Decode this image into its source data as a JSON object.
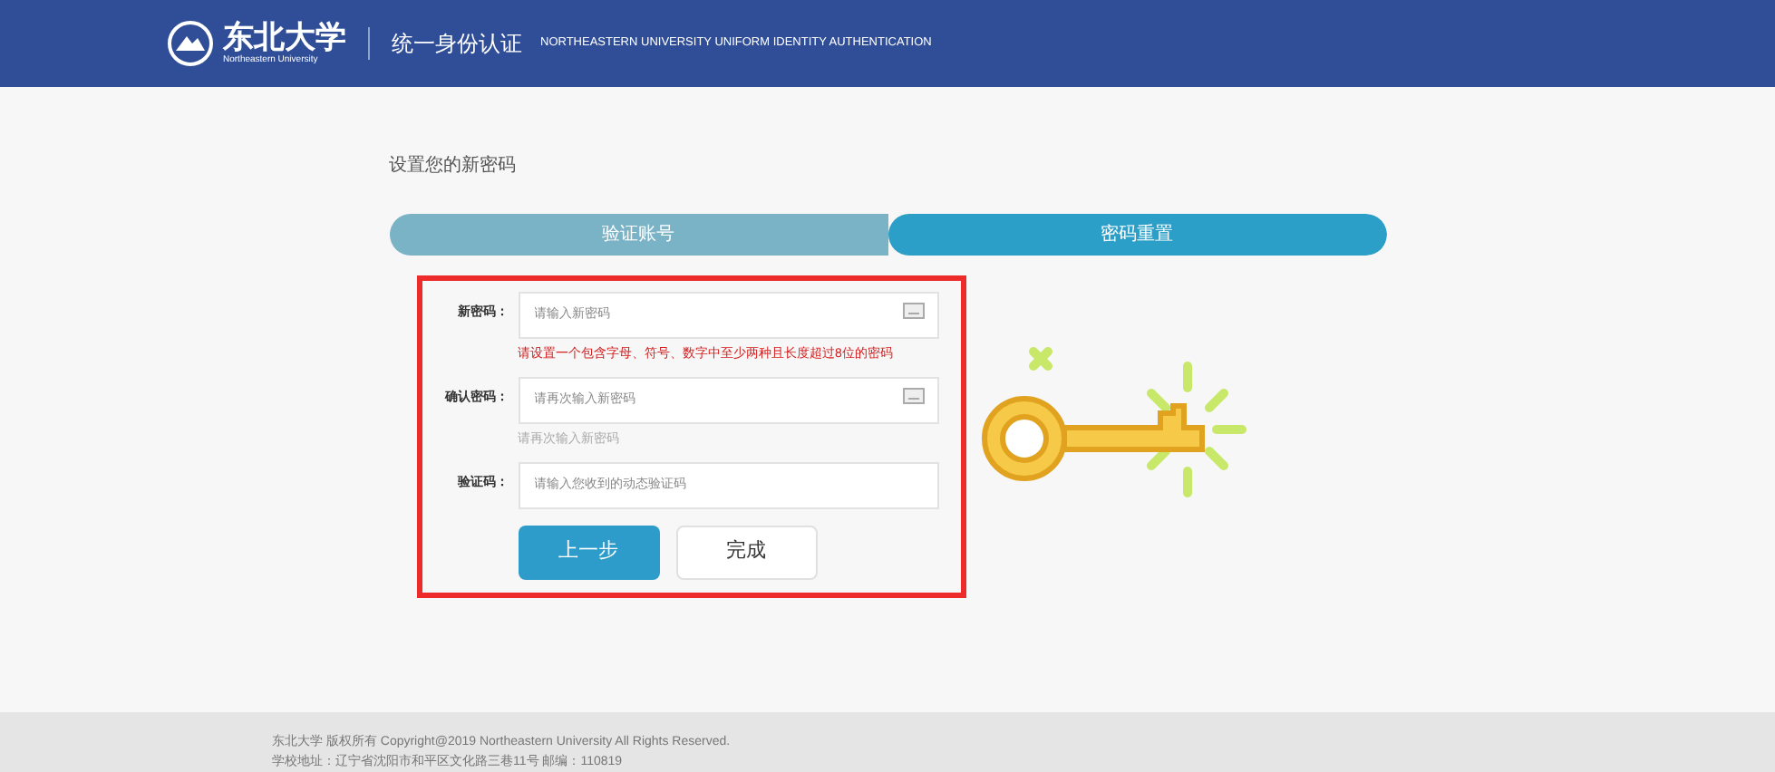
{
  "header": {
    "logo_text": "东北大学",
    "logo_subtext": "Northeastern University",
    "title": "统一身份认证",
    "subtitle": "NORTHEASTERN UNIVERSITY UNIFORM IDENTITY AUTHENTICATION"
  },
  "page_title": "设置您的新密码",
  "steps": [
    {
      "label": "验证账号",
      "selected": false
    },
    {
      "label": "密码重置",
      "selected": true
    }
  ],
  "form": {
    "fields": [
      {
        "label": "新密码：",
        "placeholder": "请输入新密码",
        "keyboard": true,
        "hint": "请设置一个包含字母、符号、数字中至少两种且长度超过8位的密码",
        "error": true
      },
      {
        "label": "确认密码：",
        "placeholder": "请再次输入新密码",
        "keyboard": true,
        "hint": "请再次输入新密码",
        "error": false
      },
      {
        "label": "验证码：",
        "placeholder": "请输入您收到的动态验证码",
        "keyboard": false
      }
    ],
    "buttons": [
      {
        "label": "上一步",
        "kind": "primary"
      },
      {
        "label": "完成",
        "kind": "secondary"
      }
    ]
  },
  "footer": [
    "东北大学 版权所有 Copyright@2019 Northeastern University All Rights Reserved.",
    "学校地址：辽宁省沈阳市和平区文化路三巷11号 邮编：110819"
  ]
}
